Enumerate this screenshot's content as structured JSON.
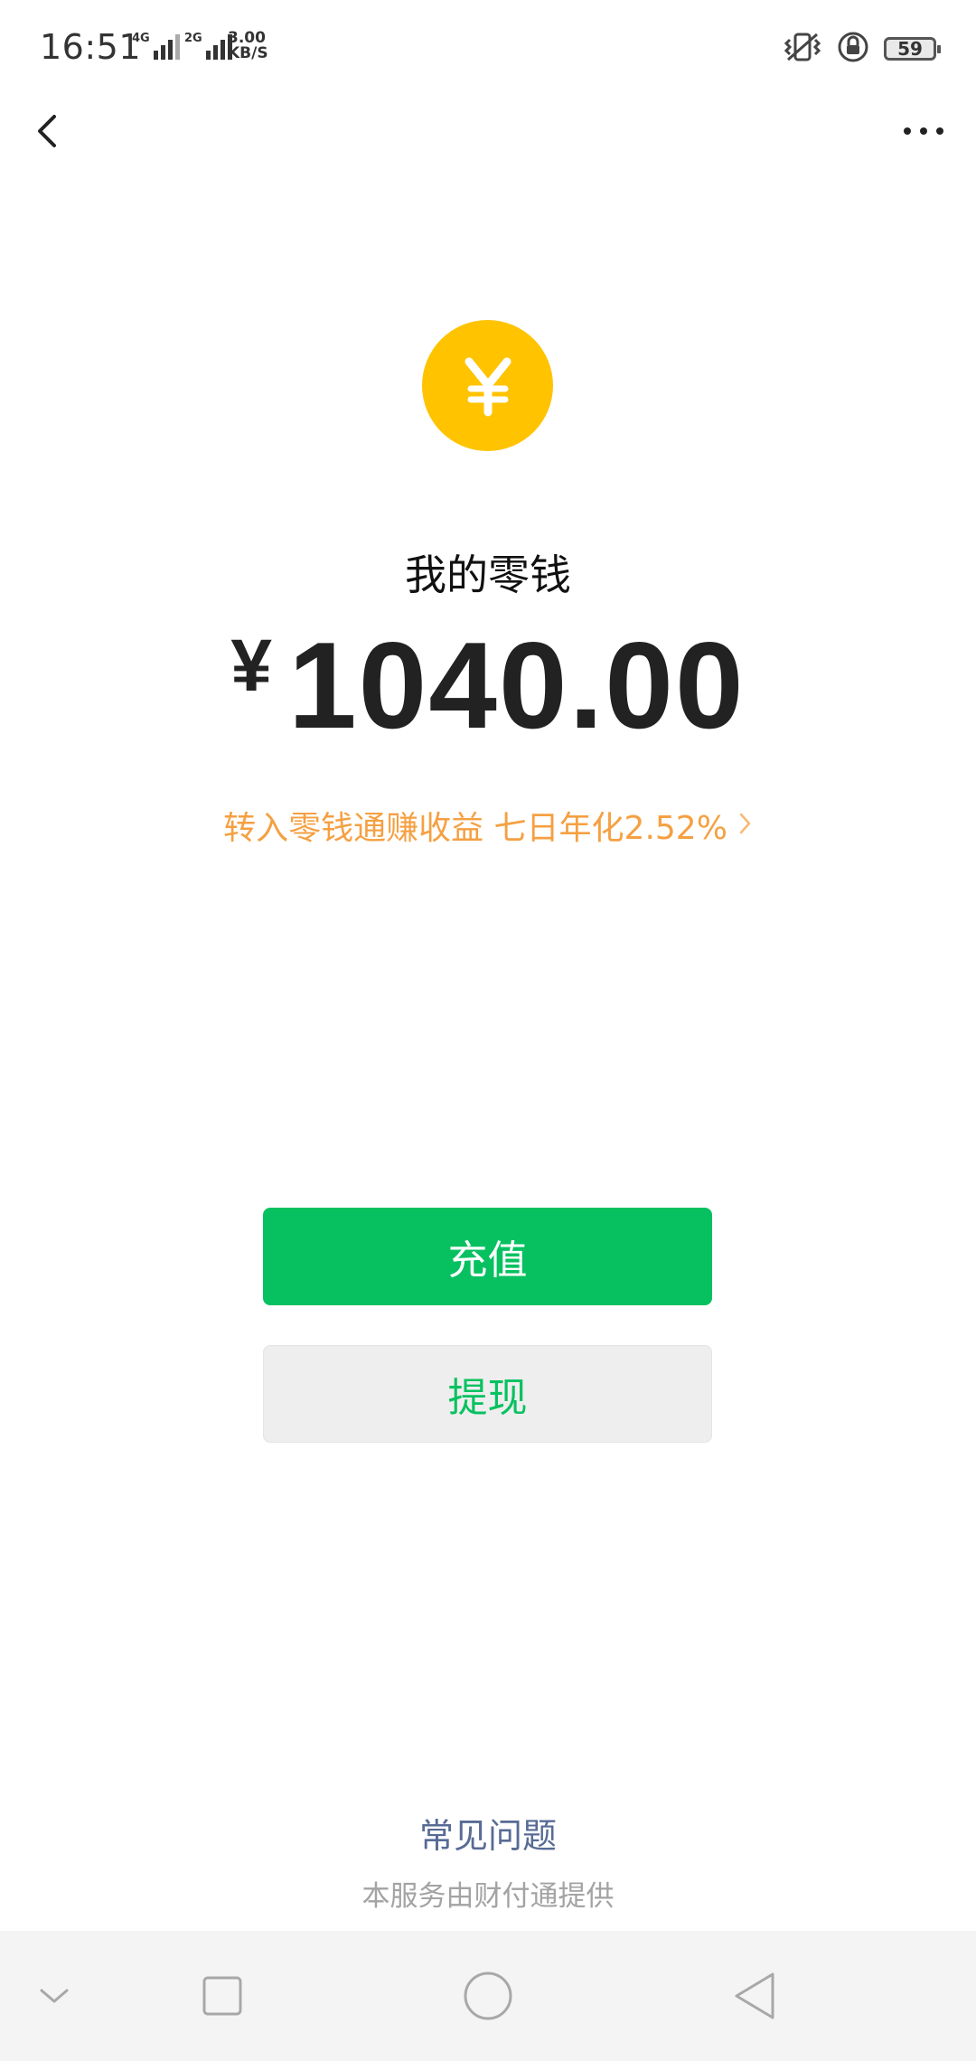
{
  "status_bar": {
    "time": "16:51",
    "network1_label": "4G",
    "network2_label": "2G",
    "speed_value": "3.00",
    "speed_unit": "KB/S",
    "battery": "59"
  },
  "nav": {
    "back_icon": "chevron-left-icon",
    "more_icon": "more-dots-icon"
  },
  "wallet": {
    "coin_symbol": "¥",
    "coin_color": "#ffc300",
    "title": "我的零钱",
    "currency": "¥",
    "balance": "1040.00",
    "promo_text": "转入零钱通赚收益 七日年化2.52%",
    "promo_color": "#f5a042"
  },
  "actions": {
    "recharge_label": "充值",
    "withdraw_label": "提现",
    "accent_color": "#07c160"
  },
  "footer": {
    "faq_label": "常见问题",
    "provider_text": "本服务由财付通提供"
  },
  "system_nav": {
    "items": [
      "chevron-down-icon",
      "square-icon",
      "circle-icon",
      "triangle-back-icon"
    ]
  }
}
